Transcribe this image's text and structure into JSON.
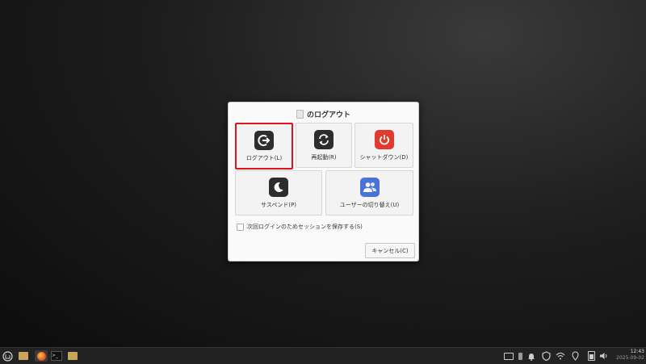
{
  "dialog": {
    "title": "のログアウト",
    "options": {
      "logout": "ログアウト(L)",
      "restart": "再起動(R)",
      "shutdown": "シャットダウン(D)",
      "suspend": "サスペンド(P)",
      "switch_user": "ユーザーの切り替え(U)"
    },
    "save_session_label": "次回ログインのためセッションを保存する(S)",
    "save_session_checked": false,
    "cancel_label": "キャンセル(C)"
  },
  "taskbar": {
    "clock_time": "12:43",
    "clock_date": "2025-09-02"
  },
  "colors": {
    "selected_border": "#e0141c",
    "shutdown_icon": "#e23b2e",
    "switch_user_icon": "#4a72d8"
  }
}
